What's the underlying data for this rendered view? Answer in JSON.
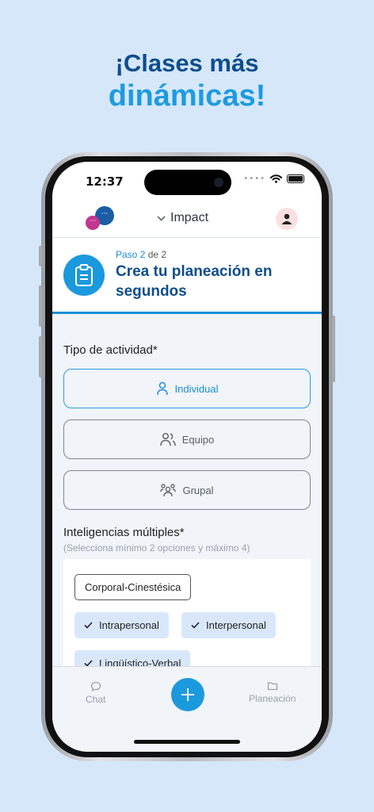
{
  "headline": {
    "line1": "¡Clases más",
    "line2": "dinámicas!"
  },
  "status_bar": {
    "time": "12:37"
  },
  "app_bar": {
    "workspace": "Impact"
  },
  "step": {
    "current": "2",
    "separator": "de",
    "total": "2",
    "prefix": "Paso",
    "title": "Crea tu planeación en segundos"
  },
  "activity": {
    "label": "Tipo de actividad*",
    "options": [
      {
        "label": "Individual",
        "icon": "person-icon",
        "selected": true
      },
      {
        "label": "Equipo",
        "icon": "people-icon",
        "selected": false
      },
      {
        "label": "Grupal",
        "icon": "group-icon",
        "selected": false
      }
    ]
  },
  "intelligences": {
    "label": "Inteligencias múltiples*",
    "hint": "(Selecciona mínimo 2 opciones y máximo 4)",
    "chips": [
      {
        "label": "Corporal-Cinestésica",
        "selected": false
      },
      {
        "label": "Intrapersonal",
        "selected": true
      },
      {
        "label": "Interpersonal",
        "selected": true
      },
      {
        "label": "Lingüístico-Verbal",
        "selected": true
      }
    ]
  },
  "tabbar": {
    "chat": "Chat",
    "planning": "Planeación"
  },
  "colors": {
    "brand_dark": "#0f4d8c",
    "brand": "#1b99dd",
    "background": "#d6e7fa",
    "chip_selected": "#d9e7fb"
  }
}
